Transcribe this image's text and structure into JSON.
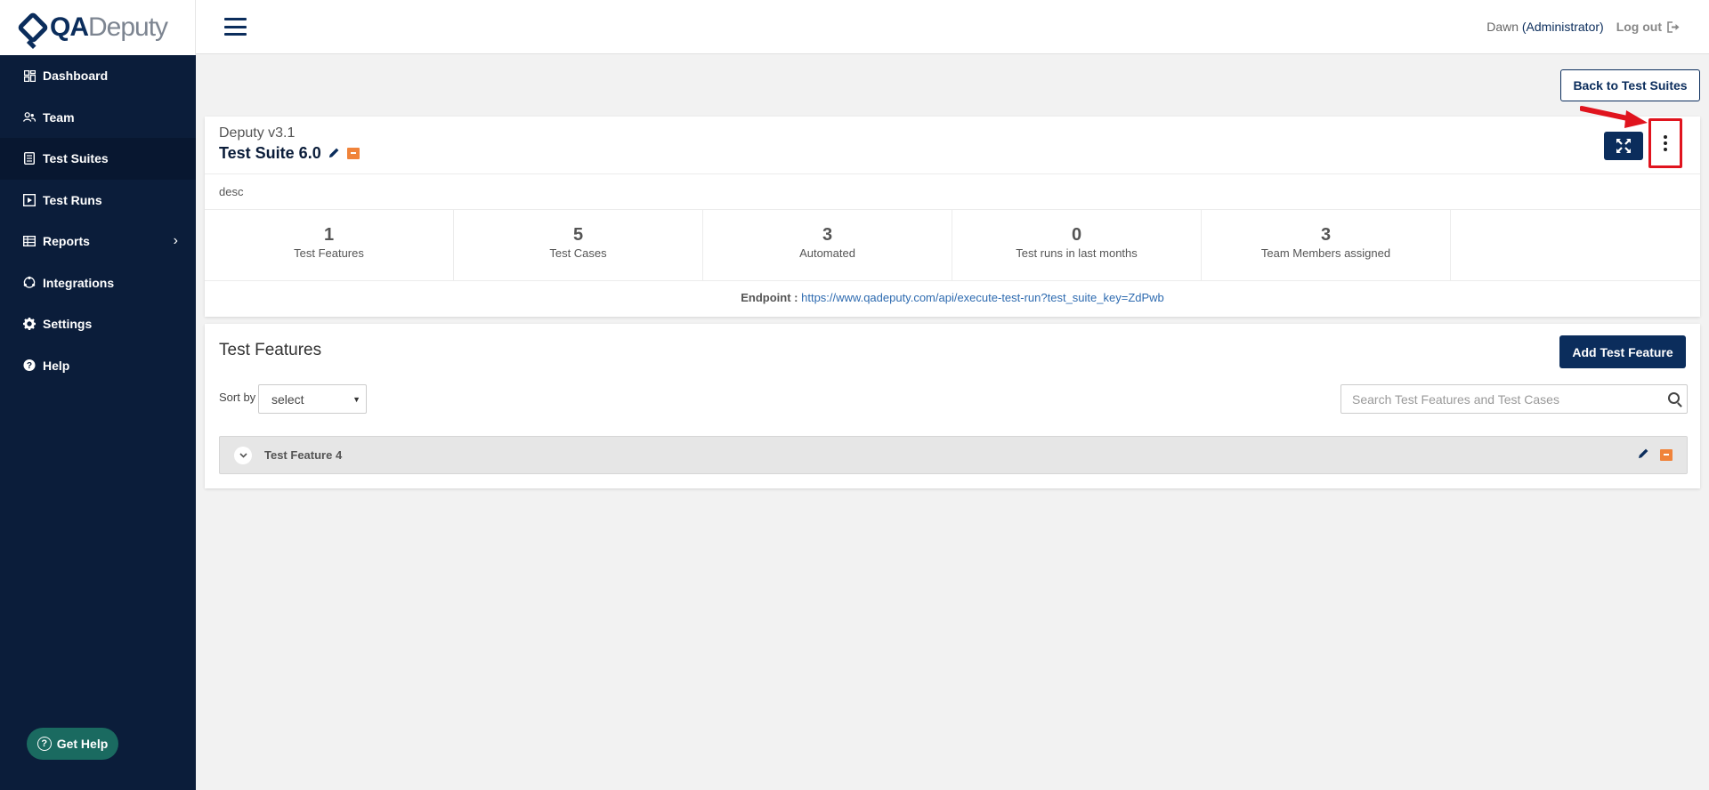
{
  "brand": {
    "qa": "QA",
    "deputy": "Deputy"
  },
  "sidebar": {
    "items": [
      {
        "label": "Dashboard",
        "icon": "dashboard-icon"
      },
      {
        "label": "Team",
        "icon": "team-icon"
      },
      {
        "label": "Test Suites",
        "icon": "test-suites-icon",
        "active": true
      },
      {
        "label": "Test Runs",
        "icon": "test-runs-icon"
      },
      {
        "label": "Reports",
        "icon": "reports-icon"
      },
      {
        "label": "Integrations",
        "icon": "integrations-icon"
      },
      {
        "label": "Settings",
        "icon": "gear-icon"
      },
      {
        "label": "Help",
        "icon": "help-icon"
      }
    ],
    "get_help": "Get Help"
  },
  "header": {
    "user": "Dawn",
    "role": "(Administrator)",
    "logout": "Log out"
  },
  "back_button": "Back to Test Suites",
  "suite": {
    "project": "Deputy v3.1",
    "title": "Test Suite 6.0",
    "description": "desc",
    "stats": [
      {
        "value": "1",
        "label": "Test Features"
      },
      {
        "value": "5",
        "label": "Test Cases"
      },
      {
        "value": "3",
        "label": "Automated"
      },
      {
        "value": "0",
        "label": "Test runs in last months"
      },
      {
        "value": "3",
        "label": "Team Members assigned"
      }
    ],
    "endpoint_label": "Endpoint :",
    "endpoint_url": "https://www.qadeputy.com/api/execute-test-run?test_suite_key=ZdPwb"
  },
  "features": {
    "title": "Test Features",
    "add_button": "Add Test Feature",
    "sort_label": "Sort by",
    "sort_value": "select",
    "search_placeholder": "Search Test Features and Test Cases",
    "rows": [
      {
        "name": "Test Feature 4"
      }
    ]
  },
  "colors": {
    "navy": "#0b2d5c",
    "sidebar": "#0b1d3a",
    "accent_orange": "#f0833a",
    "highlight_red": "#e0141e",
    "help_teal": "#1a6a60"
  }
}
